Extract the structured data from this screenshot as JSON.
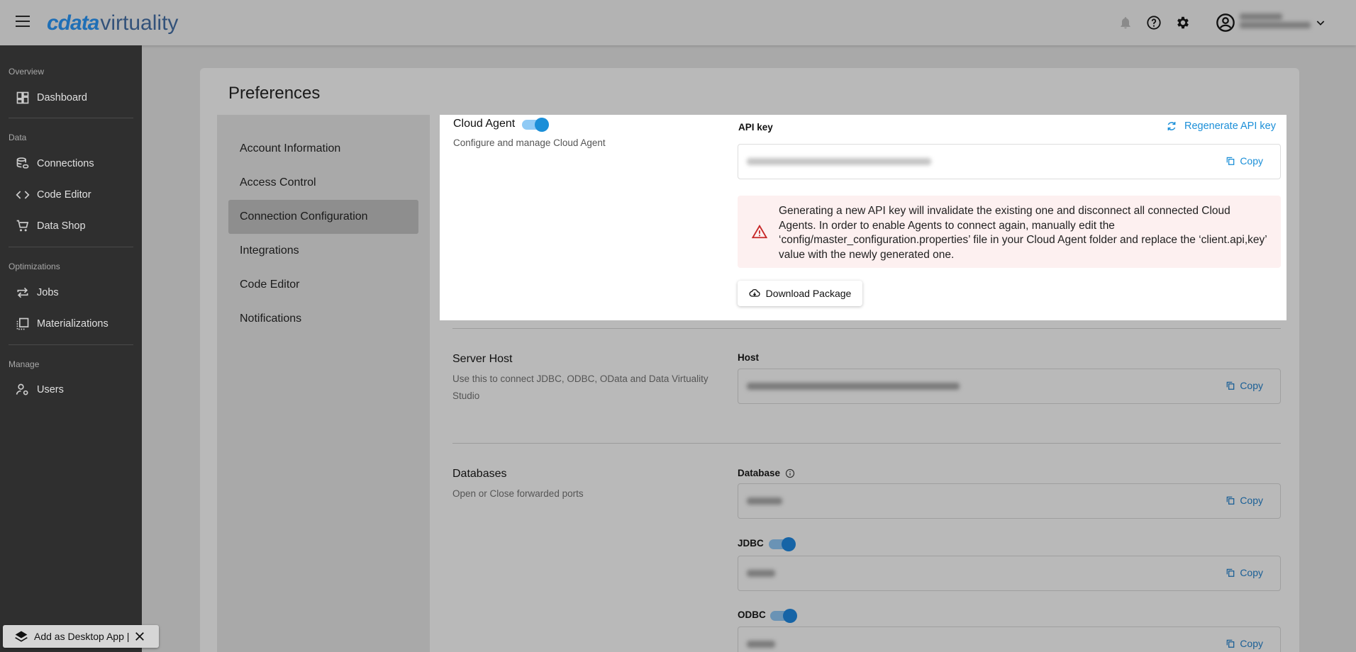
{
  "app": {
    "brand": "cdata",
    "brand_suffix": "virtuality"
  },
  "sidebar": {
    "sections": [
      {
        "title": "Overview",
        "items": [
          {
            "label": "Dashboard",
            "icon": "dashboard-icon"
          }
        ]
      },
      {
        "title": "Data",
        "items": [
          {
            "label": "Connections",
            "icon": "database-link-icon"
          },
          {
            "label": "Code Editor",
            "icon": "code-icon"
          },
          {
            "label": "Data Shop",
            "icon": "cart-icon"
          }
        ]
      },
      {
        "title": "Optimizations",
        "items": [
          {
            "label": "Jobs",
            "icon": "repeat-icon"
          },
          {
            "label": "Materializations",
            "icon": "materialization-icon"
          }
        ]
      },
      {
        "title": "Manage",
        "items": [
          {
            "label": "Users",
            "icon": "user-settings-icon"
          }
        ]
      }
    ],
    "desktop_app": "Add as Desktop App |"
  },
  "page": {
    "title": "Preferences",
    "nav": [
      {
        "label": "Account Information"
      },
      {
        "label": "Access Control"
      },
      {
        "label": "Connection Configuration",
        "active": true
      },
      {
        "label": "Integrations"
      },
      {
        "label": "Code Editor"
      },
      {
        "label": "Notifications"
      }
    ]
  },
  "cloud_agent": {
    "title": "Cloud Agent",
    "toggle_on": true,
    "description": "Configure and manage Cloud Agent",
    "api_key_label": "API key",
    "regenerate_label": "Regenerate API key",
    "copy_label": "Copy",
    "warning": "Generating a new API key will invalidate the existing one and disconnect all connected Cloud Agents. In order to enable Agents to connect again, manually edit the ‘config/master_configuration.properties’ file in your Cloud Agent folder and replace the ‘client.api,key’ value with the newly generated one.",
    "download_label": "Download Package"
  },
  "server_host": {
    "title": "Server Host",
    "description": "Use this to connect JDBC, ODBC, OData and Data Virtuality Studio",
    "host_label": "Host",
    "copy_label": "Copy"
  },
  "databases": {
    "title": "Databases",
    "description": "Open or Close forwarded ports",
    "database_label": "Database",
    "jdbc_label": "JDBC",
    "odbc_label": "ODBC",
    "copy_label": "Copy"
  },
  "colors": {
    "accent": "#1b8fd8",
    "sidebar": "#2f2f2f",
    "warning": "#c62828"
  }
}
